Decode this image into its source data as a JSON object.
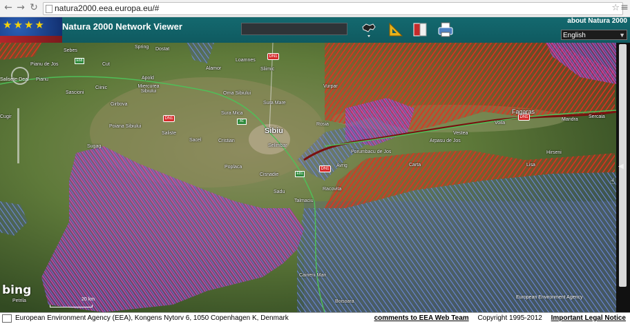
{
  "browser": {
    "url": "natura2000.eea.europa.eu/#",
    "back_icon": "←",
    "forward_icon": "→",
    "reload_icon": "↻",
    "star_icon": "☆",
    "menu_icon": "≡"
  },
  "header": {
    "title": "Natura 2000 Network Viewer",
    "about_link": "about Natura 2000",
    "language": "English",
    "search_value": "",
    "tools": [
      "world-map-tool",
      "measure-tool",
      "bookmark-tool",
      "print-tool"
    ]
  },
  "map": {
    "bing_logo": "bing",
    "scale_label": "20 km",
    "attribution": "European Environment Agency",
    "pan_label": "Salisete-Deal",
    "labels": [
      {
        "text": "Sebes",
        "pos": "a1"
      },
      {
        "text": "Spring",
        "pos": "a2"
      },
      {
        "text": "Dostat",
        "pos": "a3"
      },
      {
        "text": "Loamnes",
        "pos": "a4"
      },
      {
        "text": "Alamor",
        "pos": "a5"
      },
      {
        "text": "Sliimic",
        "pos": "a6"
      },
      {
        "text": "Pianu de Jos",
        "pos": "a7"
      },
      {
        "text": "Pianu",
        "pos": "a8"
      },
      {
        "text": "Cut",
        "pos": "a9"
      },
      {
        "text": "Apold",
        "pos": "a10"
      },
      {
        "text": "Sascioni",
        "pos": "a11"
      },
      {
        "text": "Ciinic",
        "pos": "a12"
      },
      {
        "text": "Miercurea Sibiului",
        "pos": "a13"
      },
      {
        "text": "Orna Sibiului",
        "pos": "a14"
      },
      {
        "text": "Girbova",
        "pos": "a15"
      },
      {
        "text": "Sura Mica",
        "pos": "a16"
      },
      {
        "text": "Sura Mare",
        "pos": "a17"
      },
      {
        "text": "Vurpar",
        "pos": "a18"
      },
      {
        "text": "Cugir",
        "pos": "a19"
      },
      {
        "text": "Poiana Sibiului",
        "pos": "a20"
      },
      {
        "text": "Saliste",
        "pos": "a21"
      },
      {
        "text": "Sacel",
        "pos": "a22"
      },
      {
        "text": "Cristian",
        "pos": "a23"
      },
      {
        "text": "Sibiu",
        "pos": "city"
      },
      {
        "text": "Selimbar",
        "pos": "a24"
      },
      {
        "text": "Rosia",
        "pos": "a25"
      },
      {
        "text": "Vestea",
        "pos": "a26"
      },
      {
        "text": "Voila",
        "pos": "a27"
      },
      {
        "text": "Fagaras",
        "pos": "a28"
      },
      {
        "text": "Mandra",
        "pos": "a29"
      },
      {
        "text": "Sercaia",
        "pos": "a30"
      },
      {
        "text": "Sugag",
        "pos": "a31"
      },
      {
        "text": "Poplaca",
        "pos": "a32"
      },
      {
        "text": "Cisnadie",
        "pos": "a33"
      },
      {
        "text": "Avrig",
        "pos": "a34"
      },
      {
        "text": "Porumbacu de Jos",
        "pos": "a35"
      },
      {
        "text": "Arpasu de Jos",
        "pos": "a36"
      },
      {
        "text": "Hirseni",
        "pos": "a37"
      },
      {
        "text": "Sadu",
        "pos": "a38"
      },
      {
        "text": "Racovita",
        "pos": "a39"
      },
      {
        "text": "Carta",
        "pos": "a40"
      },
      {
        "text": "Lisa",
        "pos": "a41"
      },
      {
        "text": "Talmaciu",
        "pos": "a42"
      },
      {
        "text": "Caineni Mari",
        "pos": "a43"
      },
      {
        "text": "Boisoara",
        "pos": "a44"
      },
      {
        "text": "Petrila",
        "pos": "a45"
      },
      {
        "text": "Sebes",
        "pos": "a46"
      },
      {
        "text": "Hirseni",
        "pos": "a47"
      }
    ]
  },
  "footer": {
    "org": "European Environment Agency (EEA), Kongens Nytorv 6, 1050 Copenhagen K, Denmark",
    "comments_link": "comments to EEA Web Team",
    "copyright": "Copyright 1995-2012",
    "legal_link": "Important Legal Notice"
  },
  "colors": {
    "header_bg": "#14696f",
    "spa_hatch": "#d72b1f",
    "sci_hatch": "#5c7bd6",
    "overlap_hatch": "#c03cc0"
  }
}
